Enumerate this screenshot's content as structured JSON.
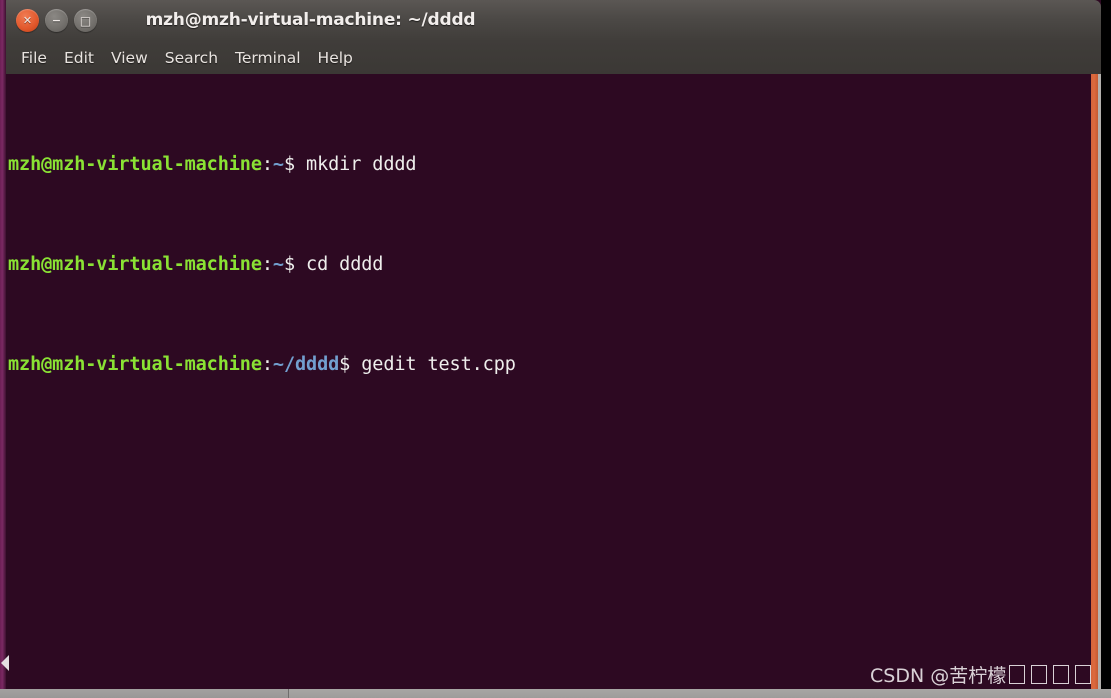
{
  "window": {
    "title": "mzh@mzh-virtual-machine: ~/dddd",
    "controls": {
      "close_glyph": "✕",
      "minimize_glyph": "−",
      "maximize_glyph": "□",
      "close_name": "close",
      "minimize_name": "minimize",
      "maximize_name": "maximize"
    }
  },
  "menubar": {
    "items": [
      {
        "label": "File"
      },
      {
        "label": "Edit"
      },
      {
        "label": "View"
      },
      {
        "label": "Search"
      },
      {
        "label": "Terminal"
      },
      {
        "label": "Help"
      }
    ]
  },
  "terminal": {
    "background_color": "#2d0922",
    "prompt_color": "#8ae234",
    "path_color": "#729fcf",
    "text_color": "#eeeeec",
    "lines": [
      {
        "user_host": "mzh@mzh-virtual-machine",
        "colon": ":",
        "path": "~",
        "dollar": "$",
        "command": " mkdir dddd"
      },
      {
        "user_host": "mzh@mzh-virtual-machine",
        "colon": ":",
        "path": "~",
        "dollar": "$",
        "command": " cd dddd"
      },
      {
        "user_host": "mzh@mzh-virtual-machine",
        "colon": ":",
        "path": "~/dddd",
        "dollar": "$",
        "command": " gedit test.cpp"
      }
    ]
  },
  "scrollbar": {
    "thumb_color": "#d4643a",
    "track_color": "#b3b0ad"
  },
  "watermark": {
    "text": "CSDN @苦柠檬",
    "missing_glyph_count": 4
  }
}
